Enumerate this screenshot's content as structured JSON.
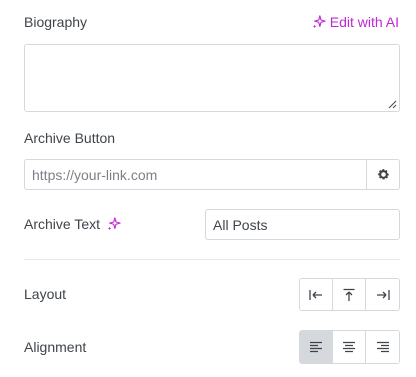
{
  "biography": {
    "label": "Biography",
    "ai_link": "Edit with AI",
    "value": ""
  },
  "archive_button": {
    "label": "Archive Button",
    "placeholder": "https://your-link.com"
  },
  "archive_text": {
    "label": "Archive Text",
    "value": "All Posts"
  },
  "layout": {
    "label": "Layout",
    "options": [
      "align-start-icon",
      "align-top-icon",
      "align-end-icon"
    ]
  },
  "alignment": {
    "label": "Alignment",
    "options": [
      "text-align-left-icon",
      "text-align-center-icon",
      "text-align-right-icon"
    ],
    "selected": "left"
  },
  "colors": {
    "accent": "#c026d3",
    "border": "#d5d8dc",
    "active": "#d5d8dc"
  }
}
